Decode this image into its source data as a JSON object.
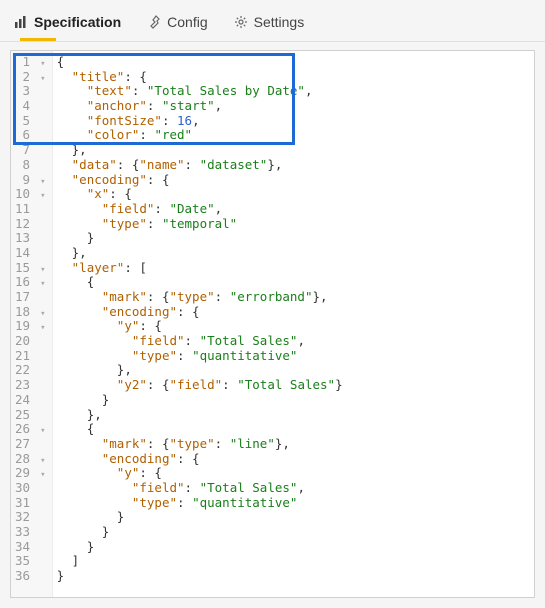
{
  "tabs": {
    "spec": {
      "label": "Specification",
      "active": true
    },
    "config": {
      "label": "Config",
      "active": false
    },
    "settings": {
      "label": "Settings",
      "active": false
    }
  },
  "code": {
    "lines": [
      {
        "n": 1,
        "fold": true,
        "indent": 0,
        "tokens": [
          [
            "brace",
            "{"
          ]
        ]
      },
      {
        "n": 2,
        "fold": true,
        "indent": 1,
        "tokens": [
          [
            "key",
            "\"title\""
          ],
          [
            "brace",
            ": {"
          ]
        ]
      },
      {
        "n": 3,
        "fold": false,
        "indent": 2,
        "tokens": [
          [
            "key",
            "\"text\""
          ],
          [
            "brace",
            ": "
          ],
          [
            "str",
            "\"Total Sales by Date\""
          ],
          [
            "brace",
            ","
          ]
        ]
      },
      {
        "n": 4,
        "fold": false,
        "indent": 2,
        "tokens": [
          [
            "key",
            "\"anchor\""
          ],
          [
            "brace",
            ": "
          ],
          [
            "str",
            "\"start\""
          ],
          [
            "brace",
            ","
          ]
        ]
      },
      {
        "n": 5,
        "fold": false,
        "indent": 2,
        "tokens": [
          [
            "key",
            "\"fontSize\""
          ],
          [
            "brace",
            ": "
          ],
          [
            "num",
            "16"
          ],
          [
            "brace",
            ","
          ]
        ]
      },
      {
        "n": 6,
        "fold": false,
        "indent": 2,
        "tokens": [
          [
            "key",
            "\"color\""
          ],
          [
            "brace",
            ": "
          ],
          [
            "str",
            "\"red\""
          ]
        ]
      },
      {
        "n": 7,
        "fold": false,
        "indent": 1,
        "tokens": [
          [
            "brace",
            "},"
          ]
        ]
      },
      {
        "n": 8,
        "fold": false,
        "indent": 1,
        "tokens": [
          [
            "key",
            "\"data\""
          ],
          [
            "brace",
            ": {"
          ],
          [
            "key",
            "\"name\""
          ],
          [
            "brace",
            ": "
          ],
          [
            "str",
            "\"dataset\""
          ],
          [
            "brace",
            "},"
          ]
        ]
      },
      {
        "n": 9,
        "fold": true,
        "indent": 1,
        "tokens": [
          [
            "key",
            "\"encoding\""
          ],
          [
            "brace",
            ": {"
          ]
        ]
      },
      {
        "n": 10,
        "fold": true,
        "indent": 2,
        "tokens": [
          [
            "key",
            "\"x\""
          ],
          [
            "brace",
            ": {"
          ]
        ]
      },
      {
        "n": 11,
        "fold": false,
        "indent": 3,
        "tokens": [
          [
            "key",
            "\"field\""
          ],
          [
            "brace",
            ": "
          ],
          [
            "str",
            "\"Date\""
          ],
          [
            "brace",
            ","
          ]
        ]
      },
      {
        "n": 12,
        "fold": false,
        "indent": 3,
        "tokens": [
          [
            "key",
            "\"type\""
          ],
          [
            "brace",
            ": "
          ],
          [
            "str",
            "\"temporal\""
          ]
        ]
      },
      {
        "n": 13,
        "fold": false,
        "indent": 2,
        "tokens": [
          [
            "brace",
            "}"
          ]
        ]
      },
      {
        "n": 14,
        "fold": false,
        "indent": 1,
        "tokens": [
          [
            "brace",
            "},"
          ]
        ]
      },
      {
        "n": 15,
        "fold": true,
        "indent": 1,
        "tokens": [
          [
            "key",
            "\"layer\""
          ],
          [
            "brace",
            ": ["
          ]
        ]
      },
      {
        "n": 16,
        "fold": true,
        "indent": 2,
        "tokens": [
          [
            "brace",
            "{"
          ]
        ]
      },
      {
        "n": 17,
        "fold": false,
        "indent": 3,
        "tokens": [
          [
            "key",
            "\"mark\""
          ],
          [
            "brace",
            ": {"
          ],
          [
            "key",
            "\"type\""
          ],
          [
            "brace",
            ": "
          ],
          [
            "str",
            "\"errorband\""
          ],
          [
            "brace",
            "},"
          ]
        ]
      },
      {
        "n": 18,
        "fold": true,
        "indent": 3,
        "tokens": [
          [
            "key",
            "\"encoding\""
          ],
          [
            "brace",
            ": {"
          ]
        ]
      },
      {
        "n": 19,
        "fold": true,
        "indent": 4,
        "tokens": [
          [
            "key",
            "\"y\""
          ],
          [
            "brace",
            ": {"
          ]
        ]
      },
      {
        "n": 20,
        "fold": false,
        "indent": 5,
        "tokens": [
          [
            "key",
            "\"field\""
          ],
          [
            "brace",
            ": "
          ],
          [
            "str",
            "\"Total Sales\""
          ],
          [
            "brace",
            ","
          ]
        ]
      },
      {
        "n": 21,
        "fold": false,
        "indent": 5,
        "tokens": [
          [
            "key",
            "\"type\""
          ],
          [
            "brace",
            ": "
          ],
          [
            "str",
            "\"quantitative\""
          ]
        ]
      },
      {
        "n": 22,
        "fold": false,
        "indent": 4,
        "tokens": [
          [
            "brace",
            "},"
          ]
        ]
      },
      {
        "n": 23,
        "fold": false,
        "indent": 4,
        "tokens": [
          [
            "key",
            "\"y2\""
          ],
          [
            "brace",
            ": {"
          ],
          [
            "key",
            "\"field\""
          ],
          [
            "brace",
            ": "
          ],
          [
            "str",
            "\"Total Sales\""
          ],
          [
            "brace",
            "}"
          ]
        ]
      },
      {
        "n": 24,
        "fold": false,
        "indent": 3,
        "tokens": [
          [
            "brace",
            "}"
          ]
        ]
      },
      {
        "n": 25,
        "fold": false,
        "indent": 2,
        "tokens": [
          [
            "brace",
            "},"
          ]
        ]
      },
      {
        "n": 26,
        "fold": true,
        "indent": 2,
        "tokens": [
          [
            "brace",
            "{"
          ]
        ]
      },
      {
        "n": 27,
        "fold": false,
        "indent": 3,
        "tokens": [
          [
            "key",
            "\"mark\""
          ],
          [
            "brace",
            ": {"
          ],
          [
            "key",
            "\"type\""
          ],
          [
            "brace",
            ": "
          ],
          [
            "str",
            "\"line\""
          ],
          [
            "brace",
            "},"
          ]
        ]
      },
      {
        "n": 28,
        "fold": true,
        "indent": 3,
        "tokens": [
          [
            "key",
            "\"encoding\""
          ],
          [
            "brace",
            ": {"
          ]
        ]
      },
      {
        "n": 29,
        "fold": true,
        "indent": 4,
        "tokens": [
          [
            "key",
            "\"y\""
          ],
          [
            "brace",
            ": {"
          ]
        ]
      },
      {
        "n": 30,
        "fold": false,
        "indent": 5,
        "tokens": [
          [
            "key",
            "\"field\""
          ],
          [
            "brace",
            ": "
          ],
          [
            "str",
            "\"Total Sales\""
          ],
          [
            "brace",
            ","
          ]
        ]
      },
      {
        "n": 31,
        "fold": false,
        "indent": 5,
        "tokens": [
          [
            "key",
            "\"type\""
          ],
          [
            "brace",
            ": "
          ],
          [
            "str",
            "\"quantitative\""
          ]
        ]
      },
      {
        "n": 32,
        "fold": false,
        "indent": 4,
        "tokens": [
          [
            "brace",
            "}"
          ]
        ]
      },
      {
        "n": 33,
        "fold": false,
        "indent": 3,
        "tokens": [
          [
            "brace",
            "}"
          ]
        ]
      },
      {
        "n": 34,
        "fold": false,
        "indent": 2,
        "tokens": [
          [
            "brace",
            "}"
          ]
        ]
      },
      {
        "n": 35,
        "fold": false,
        "indent": 1,
        "tokens": [
          [
            "brace",
            "]"
          ]
        ]
      },
      {
        "n": 36,
        "fold": false,
        "indent": 0,
        "tokens": [
          [
            "brace",
            "}"
          ]
        ]
      }
    ]
  }
}
